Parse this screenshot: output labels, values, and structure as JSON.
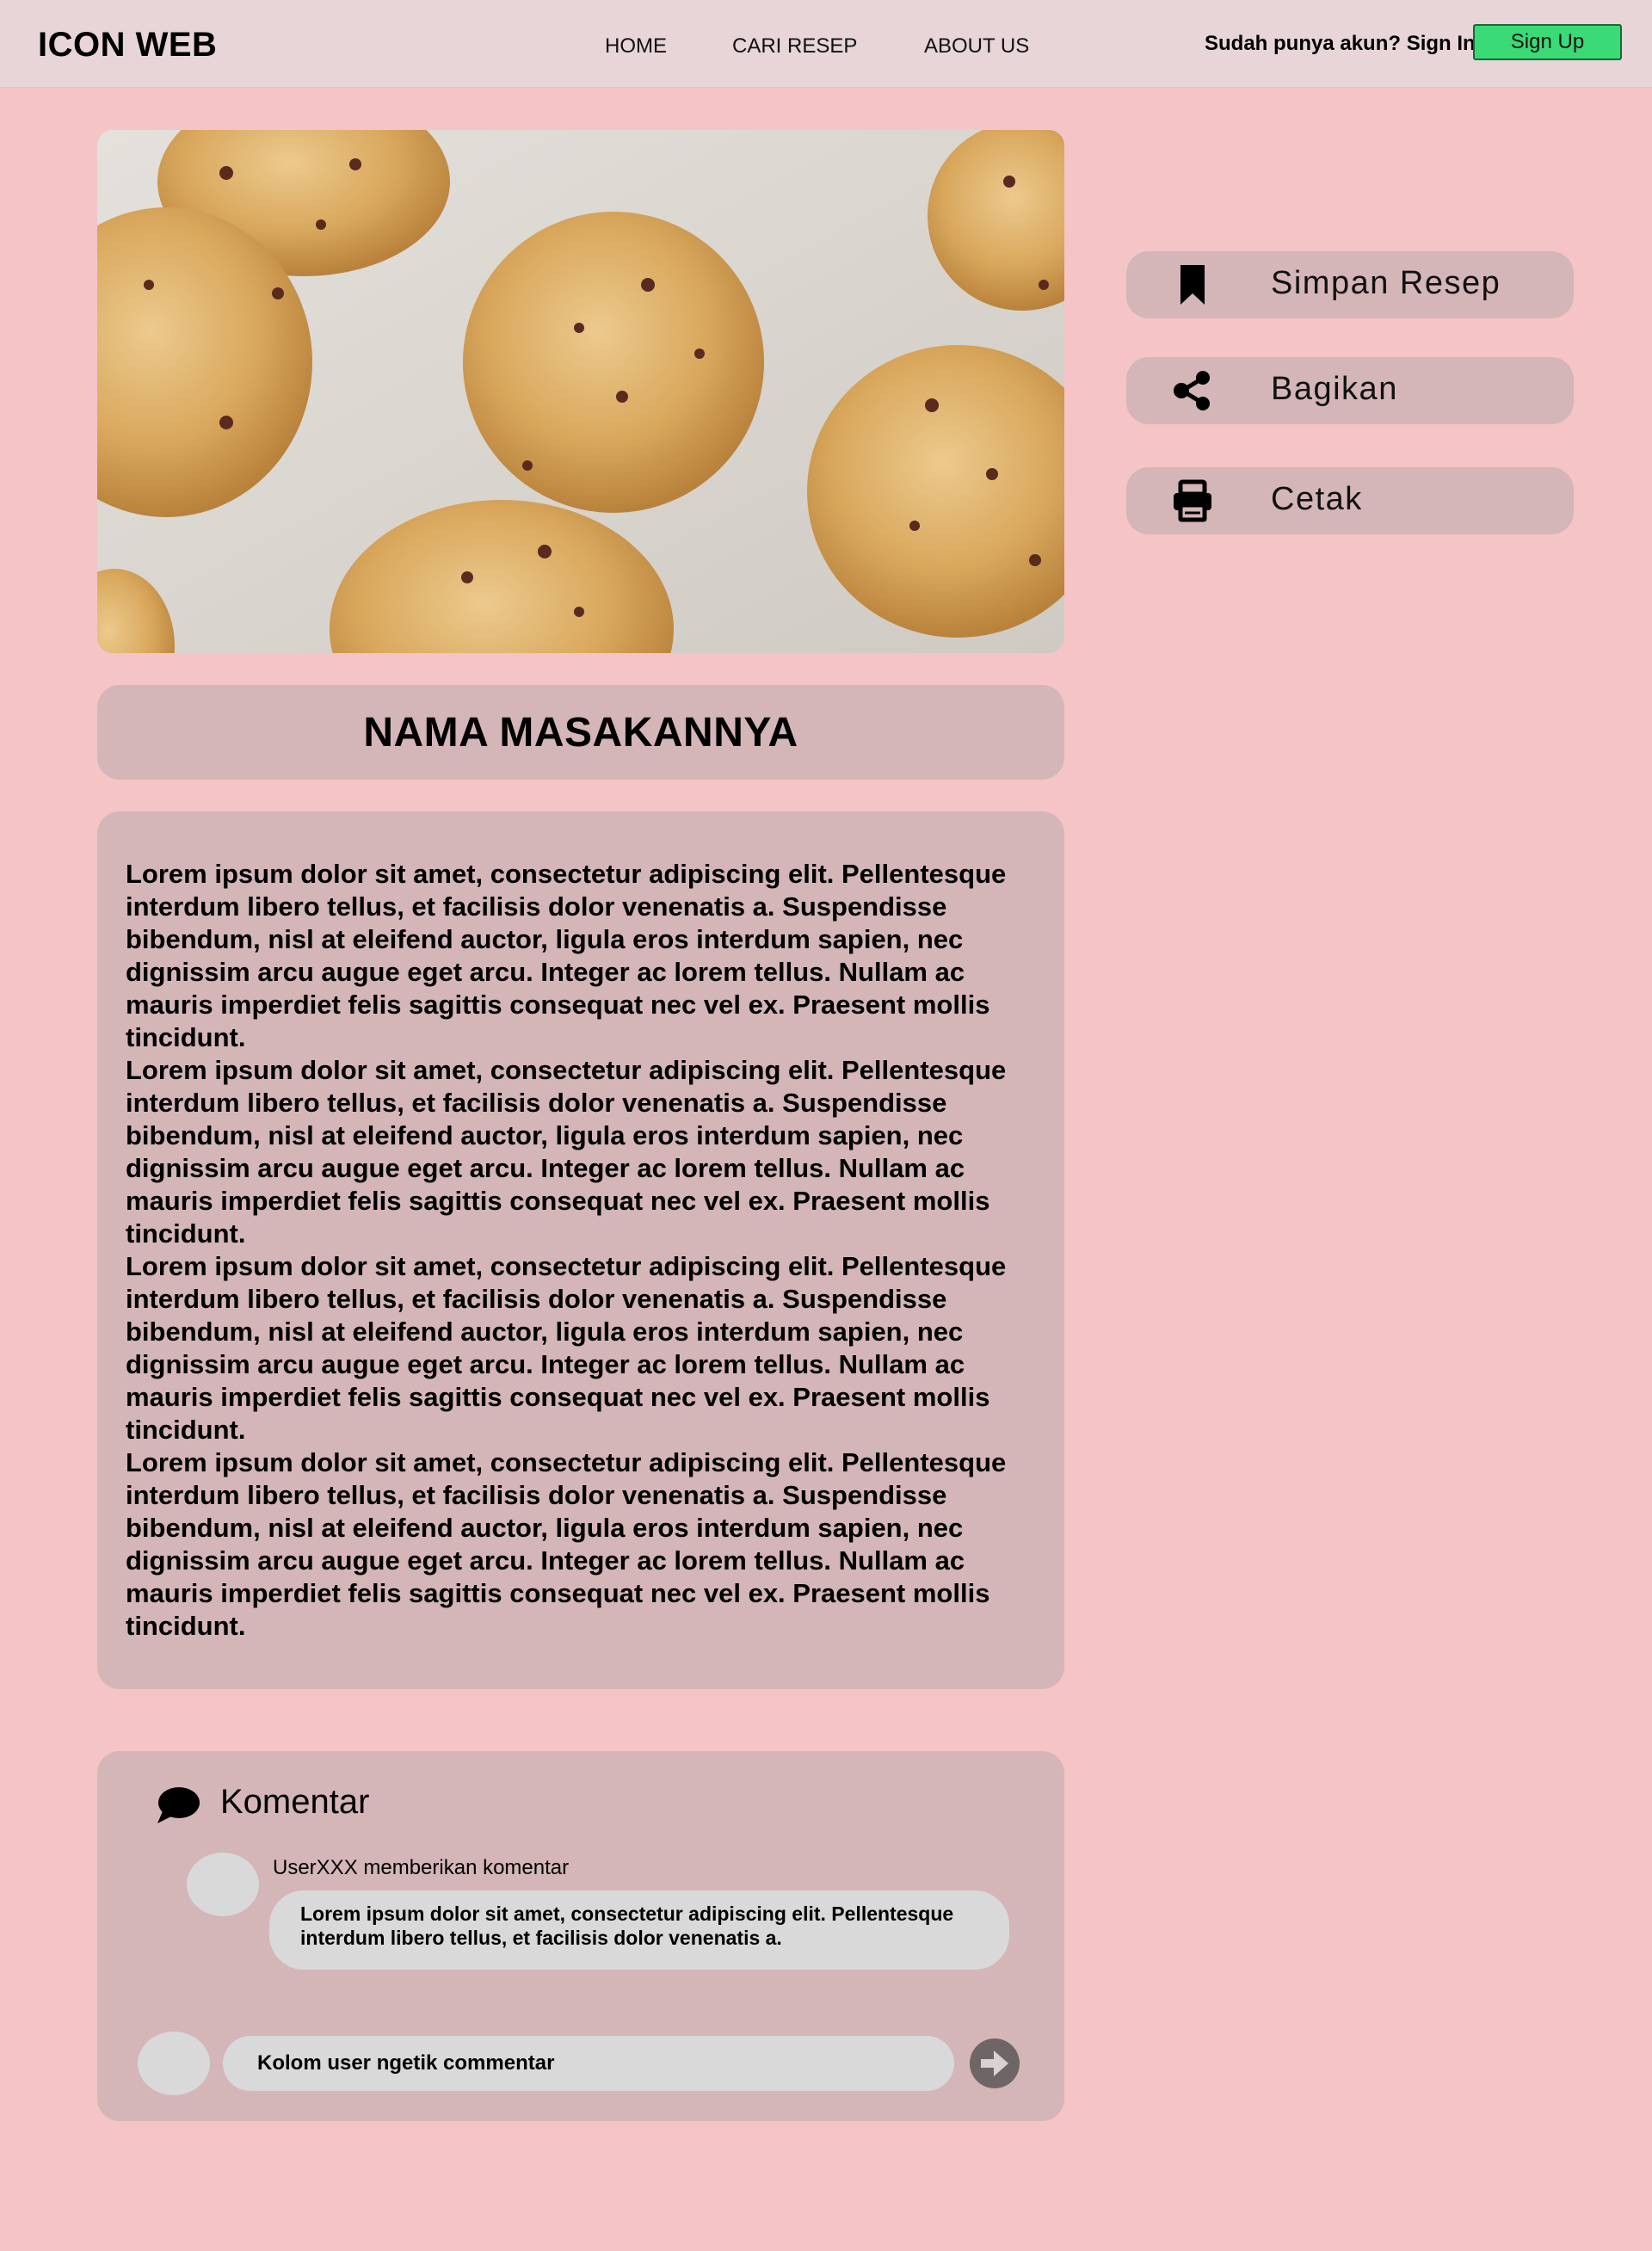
{
  "header": {
    "brand": "ICON WEB",
    "nav": [
      {
        "label": "HOME"
      },
      {
        "label": "CARI RESEP"
      },
      {
        "label": "ABOUT US"
      }
    ],
    "signin_text": "Sudah punya akun? Sign In",
    "signup_label": "Sign Up",
    "signup_color": "#3adb76"
  },
  "recipe": {
    "image_icon": "cookies-photo",
    "title": "NAMA MASAKANNYA",
    "paragraphs": [
      "Lorem ipsum dolor sit amet, consectetur adipiscing elit. Pellentesque interdum libero tellus, et facilisis dolor venenatis a. Suspendisse bibendum, nisl at eleifend auctor, ligula eros interdum sapien, nec dignissim arcu augue eget arcu. Integer ac lorem tellus. Nullam ac mauris imperdiet felis sagittis consequat nec vel ex. Praesent mollis tincidunt.",
      "Lorem ipsum dolor sit amet, consectetur adipiscing elit. Pellentesque interdum libero tellus, et facilisis dolor venenatis a. Suspendisse bibendum, nisl at eleifend auctor, ligula eros interdum sapien, nec dignissim arcu augue eget arcu. Integer ac lorem tellus. Nullam ac mauris imperdiet felis sagittis consequat nec vel ex. Praesent mollis tincidunt.",
      "Lorem ipsum dolor sit amet, consectetur adipiscing elit. Pellentesque interdum libero tellus, et facilisis dolor venenatis a. Suspendisse bibendum, nisl at eleifend auctor, ligula eros interdum sapien, nec dignissim arcu augue eget arcu. Integer ac lorem tellus. Nullam ac mauris imperdiet felis sagittis consequat nec vel ex. Praesent mollis tincidunt.",
      "Lorem ipsum dolor sit amet, consectetur adipiscing elit. Pellentesque interdum libero tellus, et facilisis dolor venenatis a. Suspendisse bibendum, nisl at eleifend auctor, ligula eros interdum sapien, nec dignissim arcu augue eget arcu. Integer ac lorem tellus. Nullam ac mauris imperdiet felis sagittis consequat nec vel ex. Praesent mollis tincidunt."
    ]
  },
  "actions": [
    {
      "label": "Simpan Resep",
      "icon": "bookmark-icon"
    },
    {
      "label": "Bagikan",
      "icon": "share-icon"
    },
    {
      "label": "Cetak",
      "icon": "print-icon"
    }
  ],
  "comments": {
    "title": "Komentar",
    "icon": "speech-bubble-icon",
    "items": [
      {
        "user_line": "UserXXX memberikan komentar",
        "text": "Lorem ipsum dolor sit amet, consectetur adipiscing elit. Pellentesque interdum libero tellus, et facilisis dolor venenatis a."
      }
    ],
    "input_placeholder": "Kolom user ngetik commentar",
    "send_icon": "arrow-right-circle-icon"
  },
  "colors": {
    "page_bg": "#f4c4c6",
    "navbar_bg": "#e7d5d7",
    "card_bg": "#d4b6b8",
    "bubble_bg": "#d9d9d9"
  }
}
